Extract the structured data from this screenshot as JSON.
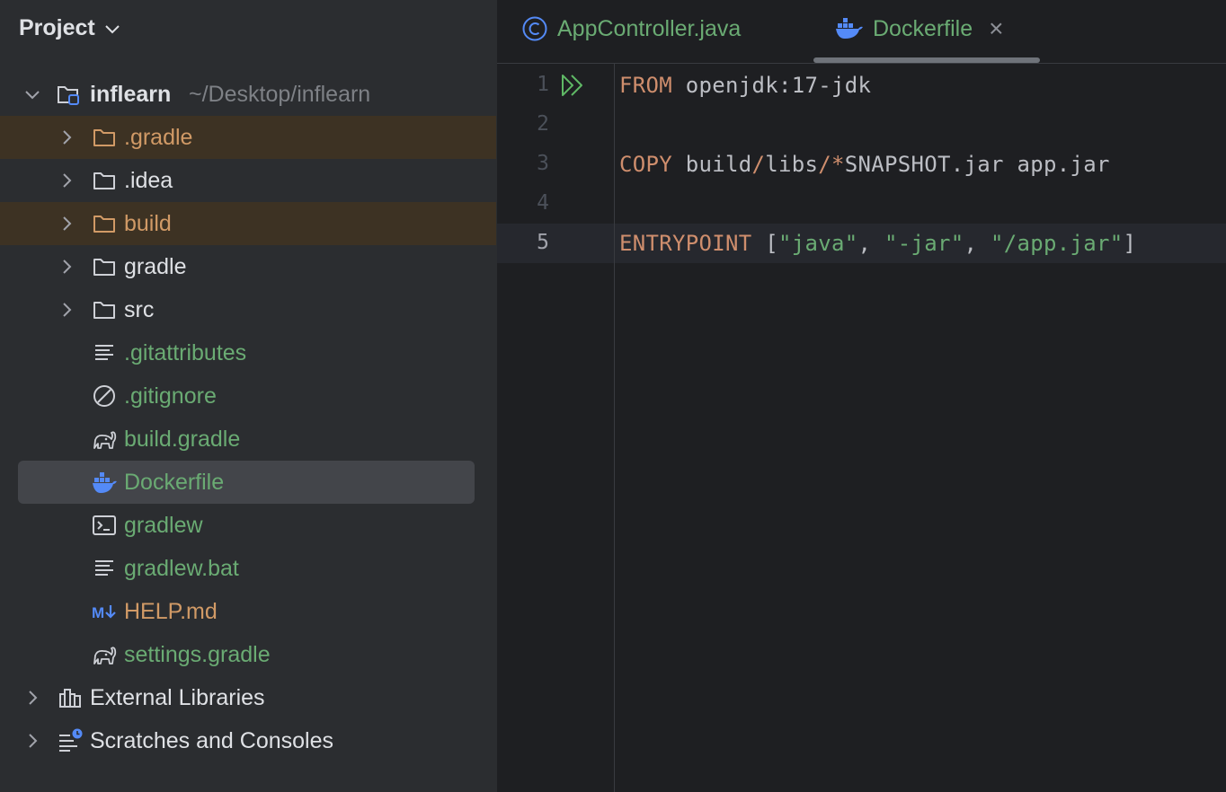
{
  "project_panel": {
    "title": "Project",
    "root": {
      "name": "inflearn",
      "path": "~/Desktop/inflearn"
    },
    "items": [
      {
        "label": ".gradle",
        "kind": "folder",
        "color": "orange",
        "excluded": true
      },
      {
        "label": ".idea",
        "kind": "folder",
        "color": "white",
        "excluded": false
      },
      {
        "label": "build",
        "kind": "folder",
        "color": "orange",
        "excluded": true
      },
      {
        "label": "gradle",
        "kind": "folder",
        "color": "white",
        "excluded": false
      },
      {
        "label": "src",
        "kind": "folder",
        "color": "white",
        "excluded": false
      },
      {
        "label": ".gitattributes",
        "kind": "text-file",
        "color": "green"
      },
      {
        "label": ".gitignore",
        "kind": "ignore-file",
        "color": "green"
      },
      {
        "label": "build.gradle",
        "kind": "gradle-file",
        "color": "green"
      },
      {
        "label": "Dockerfile",
        "kind": "docker-file",
        "color": "green",
        "selected": true
      },
      {
        "label": "gradlew",
        "kind": "shell-file",
        "color": "green"
      },
      {
        "label": "gradlew.bat",
        "kind": "text-file",
        "color": "green"
      },
      {
        "label": "HELP.md",
        "kind": "markdown-file",
        "color": "orange"
      },
      {
        "label": "settings.gradle",
        "kind": "gradle-file",
        "color": "green"
      }
    ],
    "external_libraries": "External Libraries",
    "scratches": "Scratches and Consoles"
  },
  "editor": {
    "tabs": [
      {
        "label": "AppController.java",
        "icon": "class-icon",
        "active": false
      },
      {
        "label": "Dockerfile",
        "icon": "docker-icon",
        "active": true,
        "close": "×"
      }
    ],
    "lines": [
      {
        "number": "1",
        "tokens": [
          {
            "t": "FROM",
            "c": "kw"
          },
          {
            "t": " openjdk:17-jdk",
            "c": "plain"
          }
        ]
      },
      {
        "number": "2",
        "tokens": []
      },
      {
        "number": "3",
        "tokens": [
          {
            "t": "COPY",
            "c": "kw"
          },
          {
            "t": " build",
            "c": "plain"
          },
          {
            "t": "/",
            "c": "op"
          },
          {
            "t": "libs",
            "c": "plain"
          },
          {
            "t": "/*",
            "c": "op"
          },
          {
            "t": "SNAPSHOT.jar app.jar",
            "c": "plain"
          }
        ]
      },
      {
        "number": "4",
        "tokens": []
      },
      {
        "number": "5",
        "tokens": [
          {
            "t": "ENTRYPOINT",
            "c": "kw"
          },
          {
            "t": " [",
            "c": "plain"
          },
          {
            "t": "\"java\"",
            "c": "str"
          },
          {
            "t": ", ",
            "c": "plain"
          },
          {
            "t": "\"-jar\"",
            "c": "str"
          },
          {
            "t": ", ",
            "c": "plain"
          },
          {
            "t": "\"/app.jar\"",
            "c": "str"
          },
          {
            "t": "]",
            "c": "plain"
          }
        ]
      }
    ],
    "current_line": "5"
  },
  "colors": {
    "panel_bg": "#2b2d30",
    "editor_bg": "#1e1f22",
    "excluded_bg": "#3d3223",
    "selected_bg": "#43454a",
    "green": "#6aab73",
    "orange": "#d19a66",
    "docker_blue": "#548af7"
  }
}
